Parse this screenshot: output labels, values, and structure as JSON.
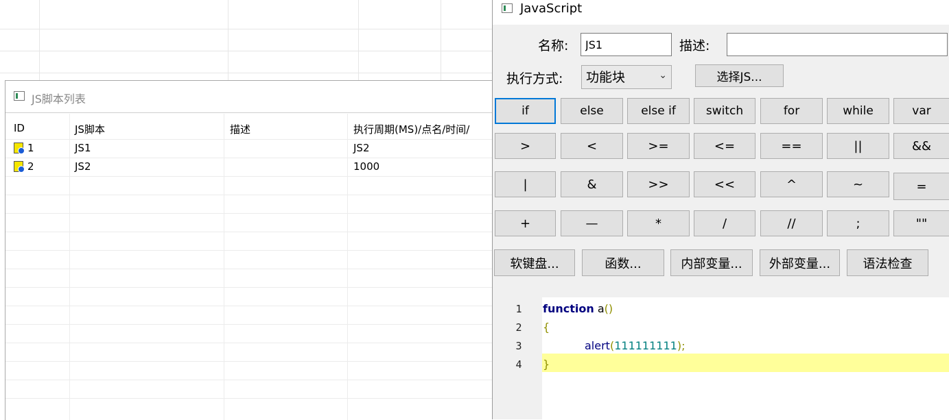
{
  "list_window": {
    "title": "JS脚本列表",
    "columns": [
      "ID",
      "JS脚本",
      "描述",
      "执行周期(MS)/点名/时间/"
    ],
    "rows": [
      {
        "id": "1",
        "script": "JS1",
        "desc": "",
        "period": "JS2"
      },
      {
        "id": "2",
        "script": "JS2",
        "desc": "",
        "period": "1000"
      }
    ]
  },
  "js_window": {
    "title": "JavaScript",
    "name_label": "名称:",
    "name_value": "JS1",
    "desc_label": "描述:",
    "desc_value": "",
    "exec_label": "执行方式:",
    "exec_selected": "功能块",
    "select_js_button": "选择JS...",
    "keyword_row1": [
      "if",
      "else",
      "else if",
      "switch",
      "for",
      "while",
      "var"
    ],
    "keyword_row2": [
      ">",
      "<",
      ">=",
      "<=",
      "==",
      "||",
      "&&"
    ],
    "keyword_row3": [
      "|",
      "&",
      ">>",
      "<<",
      "^",
      "~",
      "="
    ],
    "keyword_row4": [
      "+",
      "—",
      "*",
      "/",
      "//",
      ";",
      "\"\""
    ],
    "tool_buttons": [
      "软键盘...",
      "函数...",
      "内部变量...",
      "外部变量...",
      "语法检查"
    ],
    "code": {
      "line_numbers": [
        "1",
        "2",
        "3",
        "4"
      ],
      "line1_kw": "function",
      "line1_name": " a",
      "line1_paren": "()",
      "line2": "{",
      "line3_call": "alert",
      "line3_open": "(",
      "line3_num": "111111111",
      "line3_close": ");",
      "line4": "}"
    }
  },
  "icons": {
    "window_icon": "app-window-icon",
    "row_icon": "js-script-icon",
    "dropdown_icon": "chevron-down-icon"
  },
  "colors": {
    "focus_border": "#0078d7",
    "highlight_line": "#ffff9a",
    "keyword": "#00007f"
  }
}
